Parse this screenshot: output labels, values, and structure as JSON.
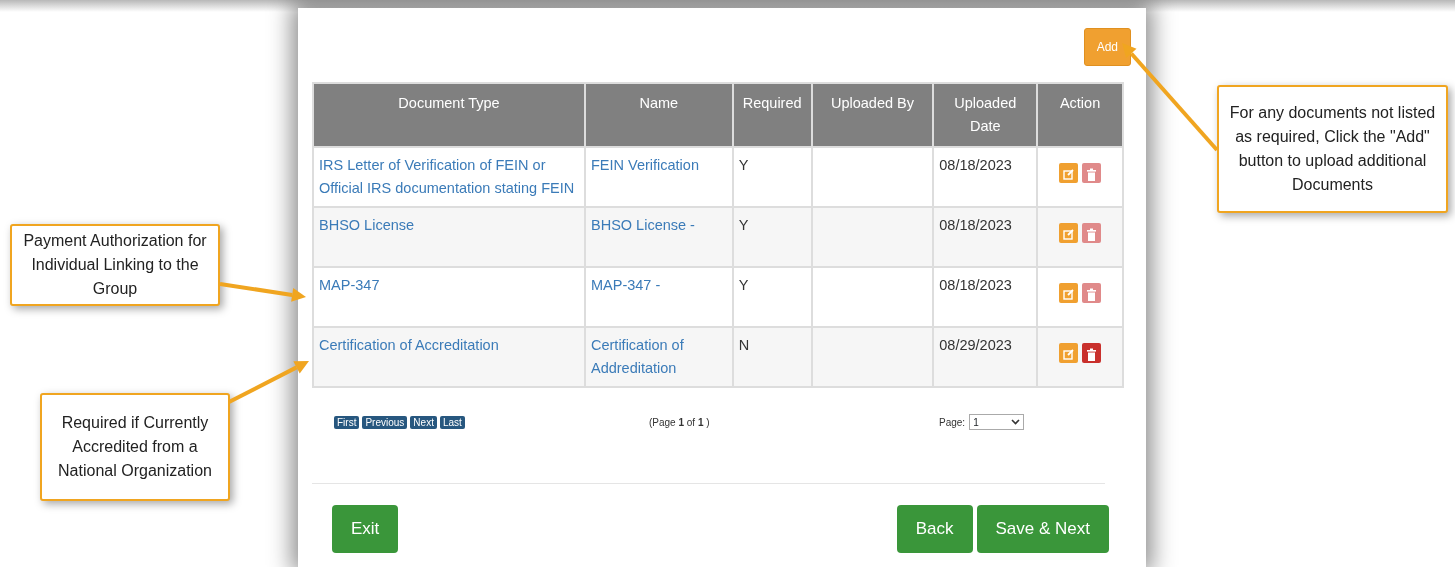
{
  "add_button": "Add",
  "table": {
    "columns": [
      "Document Type",
      "Name",
      "Required",
      "Uploaded By",
      "Uploaded Date",
      "Action"
    ],
    "rows": [
      {
        "document_type": "IRS Letter of Verification of FEIN or Official IRS documentation stating FEIN",
        "name": "FEIN Verification",
        "required": "Y",
        "uploaded_date": "08/18/2023",
        "delete_disabled": true
      },
      {
        "document_type": "BHSO License",
        "name": "BHSO License -",
        "required": "Y",
        "uploaded_date": "08/18/2023",
        "delete_disabled": true
      },
      {
        "document_type": "MAP-347",
        "name": "MAP-347 -",
        "required": "Y",
        "uploaded_date": "08/18/2023",
        "delete_disabled": true
      },
      {
        "document_type": "Certification of Accreditation",
        "name": "Certification of Addreditation",
        "required": "N",
        "uploaded_date": "08/29/2023",
        "delete_disabled": false
      }
    ]
  },
  "pagination": {
    "buttons": [
      "First",
      "Previous",
      "Next",
      "Last"
    ],
    "info": "(Page **1** of **1** )",
    "page_label": "Page:",
    "page_value": "1"
  },
  "footer_buttons": {
    "left": [
      "Exit"
    ],
    "right": [
      "Back",
      "Save & Next"
    ]
  },
  "callouts": [
    {
      "text": "Payment Authorization for Individual Linking to the Group"
    },
    {
      "text": "Required if Currently Accredited from a National Organization"
    },
    {
      "text": "For any documents not listed as required, Click the \"Add\" button to upload additional Documents"
    }
  ]
}
